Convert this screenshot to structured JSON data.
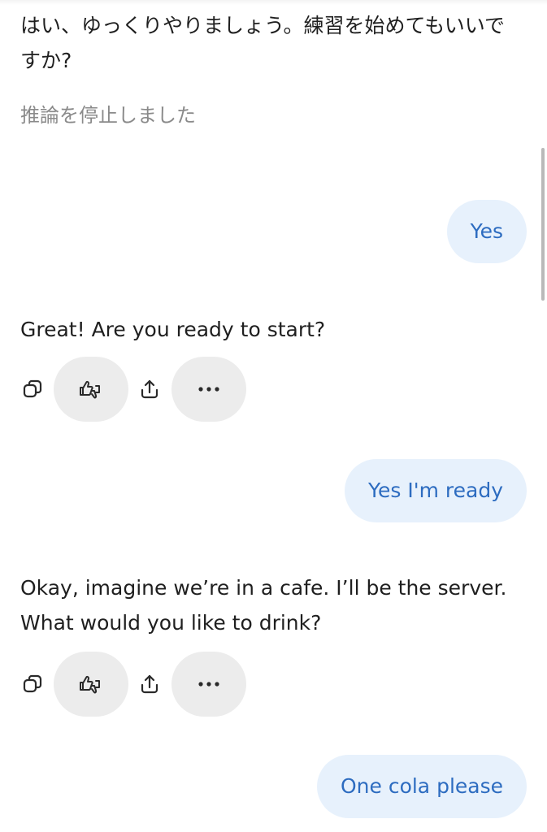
{
  "messages": {
    "ai_japanese": "はい、ゆっくりやりましょう。練習を始めてもいいですか?",
    "status_stopped": "推論を停止しました",
    "user_1": "Yes",
    "ai_2": "Great! Are you ready to start?",
    "user_2": "Yes I'm ready",
    "ai_3": "Okay, imagine we’re in a cafe. I’ll be the server. What would you like to drink?",
    "user_3": "One cola please"
  },
  "icons": {
    "copy": "copy-icon",
    "rate": "thumbs-up-down-icon",
    "share": "share-icon",
    "more": "more-dots-icon"
  },
  "colors": {
    "user_bubble_bg": "#e7f1fc",
    "user_bubble_text": "#2d6cc0",
    "action_pill_bg": "#ececec",
    "status_text": "#8a8a8a"
  }
}
